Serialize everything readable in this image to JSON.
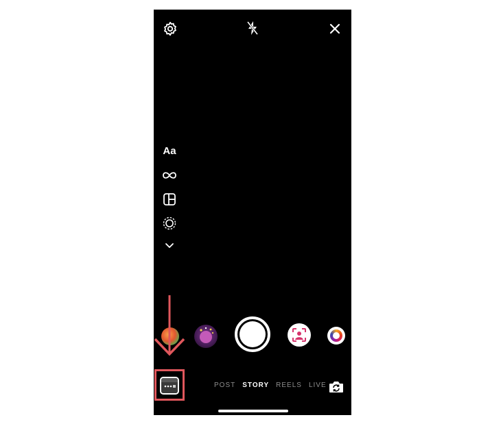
{
  "camera": {
    "top_bar": {
      "settings_icon": "gear-icon",
      "flash_icon": "flash-off-icon",
      "close_icon": "close-icon"
    },
    "side_tools": {
      "text_label": "Aa",
      "items": [
        "text-create-icon",
        "boomerang-infinity-icon",
        "layout-icon",
        "dashed-circle-icon",
        "chevron-down-icon"
      ]
    },
    "filters": [
      "face-effect-filter",
      "sparkle-portrait-filter",
      "capture-button",
      "portrait-frame-filter",
      "color-ring-filter"
    ],
    "modes": [
      {
        "label": "POST",
        "active": false
      },
      {
        "label": "STORY",
        "active": true
      },
      {
        "label": "REELS",
        "active": false
      },
      {
        "label": "LIVE",
        "active": false
      }
    ],
    "bottom": {
      "gallery_icon": "gallery-thumbnail",
      "flip_icon": "flip-camera-icon"
    }
  },
  "annotation": {
    "arrow_color": "#e0575c",
    "highlight_color": "#e0575c"
  },
  "colors": {
    "background": "#000000",
    "active_mode": "#ffffff",
    "inactive_mode": "#8e8e8e"
  }
}
